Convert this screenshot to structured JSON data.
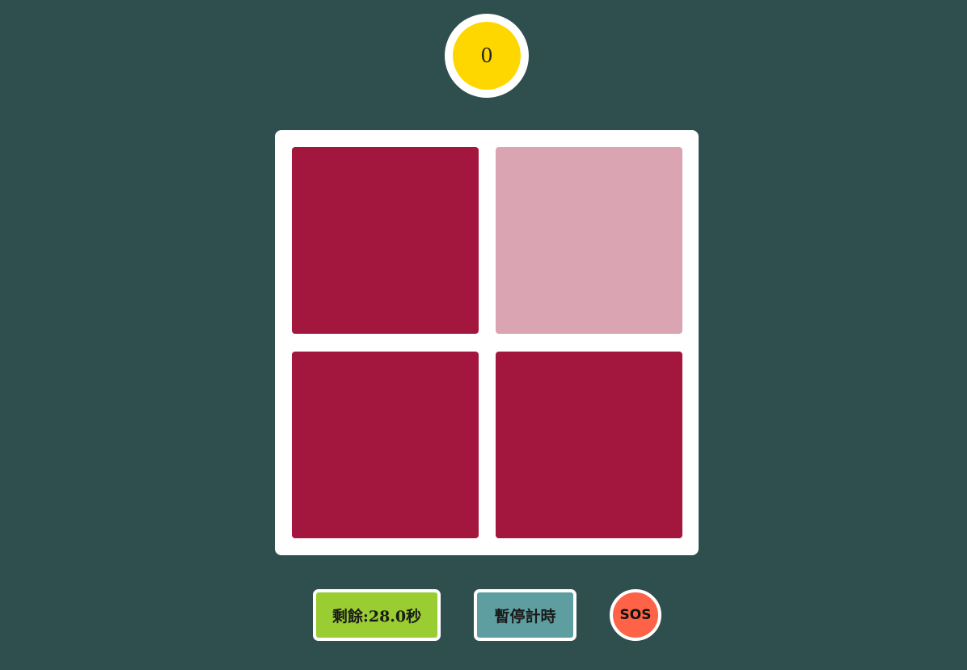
{
  "score": {
    "value": "0",
    "badge_color": "#ffd700"
  },
  "board": {
    "tiles": [
      {
        "color": "#a3173f",
        "state": "normal"
      },
      {
        "color": "#dba4b2",
        "state": "odd"
      },
      {
        "color": "#a3173f",
        "state": "normal"
      },
      {
        "color": "#a3173f",
        "state": "normal"
      }
    ]
  },
  "controls": {
    "timer_label": "剩餘:28.0秒",
    "timer_color": "#9acd32",
    "pause_label": "暫停計時",
    "pause_color": "#5f9ea0",
    "sos_label": "SOS",
    "sos_color": "#ff6347"
  }
}
